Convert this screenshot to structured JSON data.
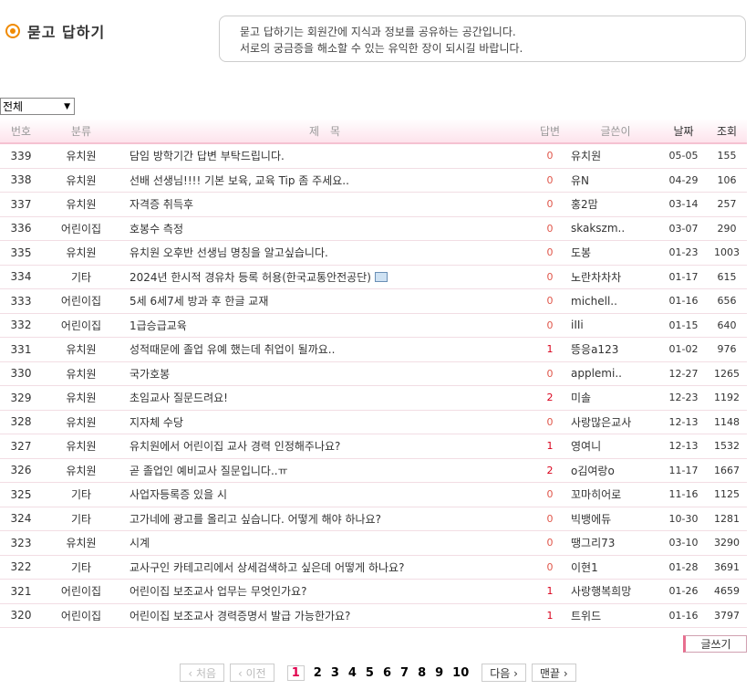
{
  "page": {
    "title": "묻고 답하기",
    "desc_line1": "묻고 답하기는 회원간에 지식과 정보를 공유하는 공간입니다.",
    "desc_line2": "서로의 궁금증을 해소할 수 있는 유익한 장이 되시길 바랍니다."
  },
  "filter": {
    "selected": "전체"
  },
  "table": {
    "headers": {
      "no": "번호",
      "cat": "분류",
      "subject": "제　목",
      "answers": "답변",
      "author": "글쓴이",
      "date": "날짜",
      "views": "조회"
    },
    "rows": [
      {
        "no": "339",
        "cat": "유치원",
        "subject": "담임 방학기간 답변 부탁드립니다.",
        "ans": "0",
        "author": "유치원",
        "date": "05-05",
        "views": "155"
      },
      {
        "no": "338",
        "cat": "유치원",
        "subject": "선배 선생님!!!! 기본 보육, 교육 Tip 좀 주세요..",
        "ans": "0",
        "author": "유N",
        "date": "04-29",
        "views": "106"
      },
      {
        "no": "337",
        "cat": "유치원",
        "subject": "자격증 취득후",
        "ans": "0",
        "author": "홍2맘",
        "date": "03-14",
        "views": "257"
      },
      {
        "no": "336",
        "cat": "어린이집",
        "subject": "호봉수 측정",
        "ans": "0",
        "author": "skakszm..",
        "date": "03-07",
        "views": "290"
      },
      {
        "no": "335",
        "cat": "유치원",
        "subject": "유치원 오후반 선생님 명칭을 알고싶습니다.",
        "ans": "0",
        "author": "도봉",
        "date": "01-23",
        "views": "1003"
      },
      {
        "no": "334",
        "cat": "기타",
        "subject": "2024년 한시적 경유차 등록 허용(한국교통안전공단)",
        "ans": "0",
        "author": "노란차차차",
        "date": "01-17",
        "views": "615",
        "icon": "monitor-icon"
      },
      {
        "no": "333",
        "cat": "어린이집",
        "subject": "5세 6세7세 방과 후 한글 교재",
        "ans": "0",
        "author": "michell..",
        "date": "01-16",
        "views": "656"
      },
      {
        "no": "332",
        "cat": "어린이집",
        "subject": "1급승급교육",
        "ans": "0",
        "author": "iIIi",
        "date": "01-15",
        "views": "640"
      },
      {
        "no": "331",
        "cat": "유치원",
        "subject": "성적때문에 졸업 유예 했는데 취업이 될까요..",
        "ans": "1",
        "author": "뜽응a123",
        "date": "01-02",
        "views": "976"
      },
      {
        "no": "330",
        "cat": "유치원",
        "subject": "국가호봉",
        "ans": "0",
        "author": "applemi..",
        "date": "12-27",
        "views": "1265"
      },
      {
        "no": "329",
        "cat": "유치원",
        "subject": "초임교사 질문드려요!",
        "ans": "2",
        "author": "미솔",
        "date": "12-23",
        "views": "1192"
      },
      {
        "no": "328",
        "cat": "유치원",
        "subject": "지자체 수당",
        "ans": "0",
        "author": "사랑많은교사",
        "date": "12-13",
        "views": "1148"
      },
      {
        "no": "327",
        "cat": "유치원",
        "subject": "유치원에서 어린이집 교사 경력 인정해주나요?",
        "ans": "1",
        "author": "영여니",
        "date": "12-13",
        "views": "1532"
      },
      {
        "no": "326",
        "cat": "유치원",
        "subject": "곧 졸업인 예비교사 질문입니다..ㅠ",
        "ans": "2",
        "author": "o김여랑o",
        "date": "11-17",
        "views": "1667"
      },
      {
        "no": "325",
        "cat": "기타",
        "subject": "사업자등록증 있을 시",
        "ans": "0",
        "author": "꼬마히어로",
        "date": "11-16",
        "views": "1125"
      },
      {
        "no": "324",
        "cat": "기타",
        "subject": "고가네에 광고를 올리고 싶습니다. 어떻게 해야 하나요?",
        "ans": "0",
        "author": "빅뱅에듀",
        "date": "10-30",
        "views": "1281"
      },
      {
        "no": "323",
        "cat": "유치원",
        "subject": "시계",
        "ans": "0",
        "author": "땡그리73",
        "date": "03-10",
        "views": "3290"
      },
      {
        "no": "322",
        "cat": "기타",
        "subject": "교사구인 카테고리에서 상세검색하고 싶은데 어떻게 하나요?",
        "ans": "0",
        "author": "이현1",
        "date": "01-28",
        "views": "3691"
      },
      {
        "no": "321",
        "cat": "어린이집",
        "subject": "어린이집 보조교사 업무는 무엇인가요?",
        "ans": "1",
        "author": "사랑행복희망",
        "date": "01-26",
        "views": "4659"
      },
      {
        "no": "320",
        "cat": "어린이집",
        "subject": "어린이집 보조교사 경력증명서 발급 가능한가요?",
        "ans": "1",
        "author": "트위드",
        "date": "01-16",
        "views": "3797"
      }
    ]
  },
  "actions": {
    "write": "글쓰기"
  },
  "pager": {
    "first": "‹ 처음",
    "prev": "‹ 이전",
    "pages": [
      "1",
      "2",
      "3",
      "4",
      "5",
      "6",
      "7",
      "8",
      "9",
      "10"
    ],
    "current": "1",
    "next": "다음 ›",
    "last": "맨끝 ›"
  },
  "colors": {
    "accent": "#f08a00",
    "answer_red": "#e0564a",
    "header_pink": "#fde3ec"
  }
}
